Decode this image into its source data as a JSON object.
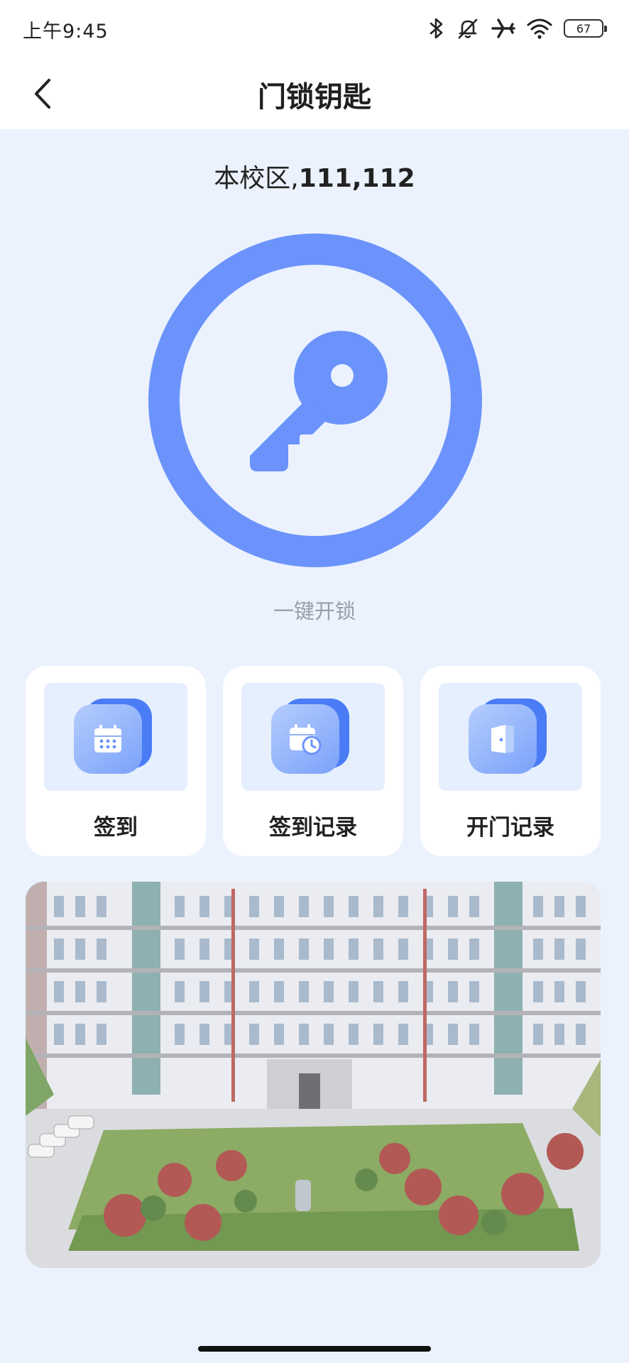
{
  "status_bar": {
    "time": "上午9:45",
    "battery": "67",
    "icons": [
      "bluetooth-icon",
      "mute-icon",
      "airplane-icon",
      "wifi-icon",
      "battery-icon"
    ]
  },
  "header": {
    "title": "门锁钥匙",
    "back_icon": "chevron-left-icon"
  },
  "campus": {
    "name": "本校区,",
    "rooms": "111,112"
  },
  "unlock": {
    "icon": "key-icon",
    "label": "一键开锁",
    "color": "#6b93fb"
  },
  "actions": [
    {
      "label": "签到",
      "icon": "calendar-icon"
    },
    {
      "label": "签到记录",
      "icon": "calendar-clock-icon"
    },
    {
      "label": "开门记录",
      "icon": "door-icon"
    }
  ],
  "colors": {
    "accent": "#6b93fb",
    "background": "#ebf2fd",
    "card": "#ffffff"
  }
}
